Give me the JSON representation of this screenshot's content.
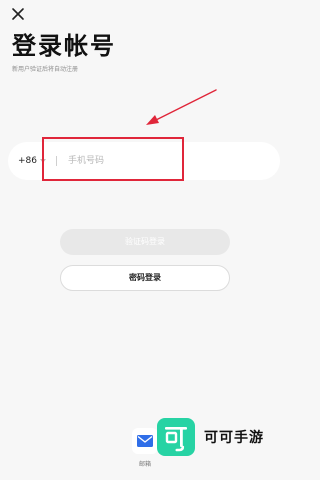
{
  "header": {
    "title": "登录帐号",
    "subtitle": "新用户验证后将自动注册"
  },
  "phone": {
    "country_code": "+86",
    "placeholder": "手机号码",
    "value": ""
  },
  "buttons": {
    "code_login": "验证码登录",
    "password_login": "密码登录"
  },
  "alt_login": {
    "mail_label": "邮箱"
  },
  "watermark": {
    "text": "可可手游"
  },
  "colors": {
    "background": "#f7f7f7",
    "annotation": "#e0263a",
    "disabled_button": "#e8e8e8",
    "mail_blue": "#2f6ee8",
    "watermark_green": "#27d3a4"
  },
  "icons": {
    "close": "close-icon",
    "caret": "chevron-down-icon",
    "mail": "mail-icon",
    "arrow": "annotation-arrow",
    "watermark_logo": "watermark-logo"
  }
}
